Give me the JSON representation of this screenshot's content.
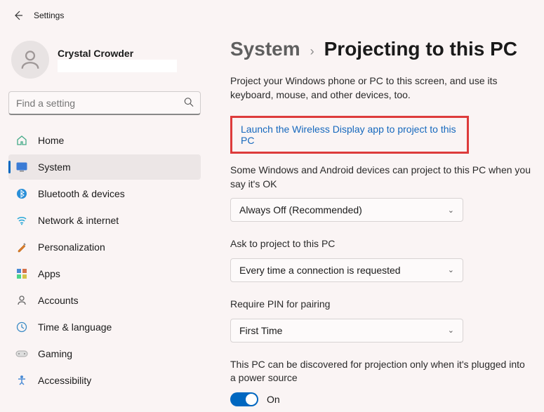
{
  "window": {
    "title": "Settings"
  },
  "user": {
    "name": "Crystal Crowder"
  },
  "search": {
    "placeholder": "Find a setting"
  },
  "sidebar": {
    "items": [
      {
        "label": "Home",
        "icon": "home"
      },
      {
        "label": "System",
        "icon": "system",
        "selected": true
      },
      {
        "label": "Bluetooth & devices",
        "icon": "bluetooth"
      },
      {
        "label": "Network & internet",
        "icon": "wifi"
      },
      {
        "label": "Personalization",
        "icon": "personalization"
      },
      {
        "label": "Apps",
        "icon": "apps"
      },
      {
        "label": "Accounts",
        "icon": "accounts"
      },
      {
        "label": "Time & language",
        "icon": "time"
      },
      {
        "label": "Gaming",
        "icon": "gaming"
      },
      {
        "label": "Accessibility",
        "icon": "accessibility"
      }
    ]
  },
  "breadcrumb": {
    "parent": "System",
    "current": "Projecting to this PC"
  },
  "intro": "Project your Windows phone or PC to this screen, and use its keyboard, mouse, and other devices, too.",
  "launchLink": "Launch the Wireless Display app to project to this PC",
  "settings": {
    "permission": {
      "label": "Some Windows and Android devices can project to this PC when you say it's OK",
      "value": "Always Off (Recommended)"
    },
    "ask": {
      "label": "Ask to project to this PC",
      "value": "Every time a connection is requested"
    },
    "pin": {
      "label": "Require PIN for pairing",
      "value": "First Time"
    },
    "plugged": {
      "label": "This PC can be discovered for projection only when it's plugged into a power source",
      "state": "On"
    }
  }
}
